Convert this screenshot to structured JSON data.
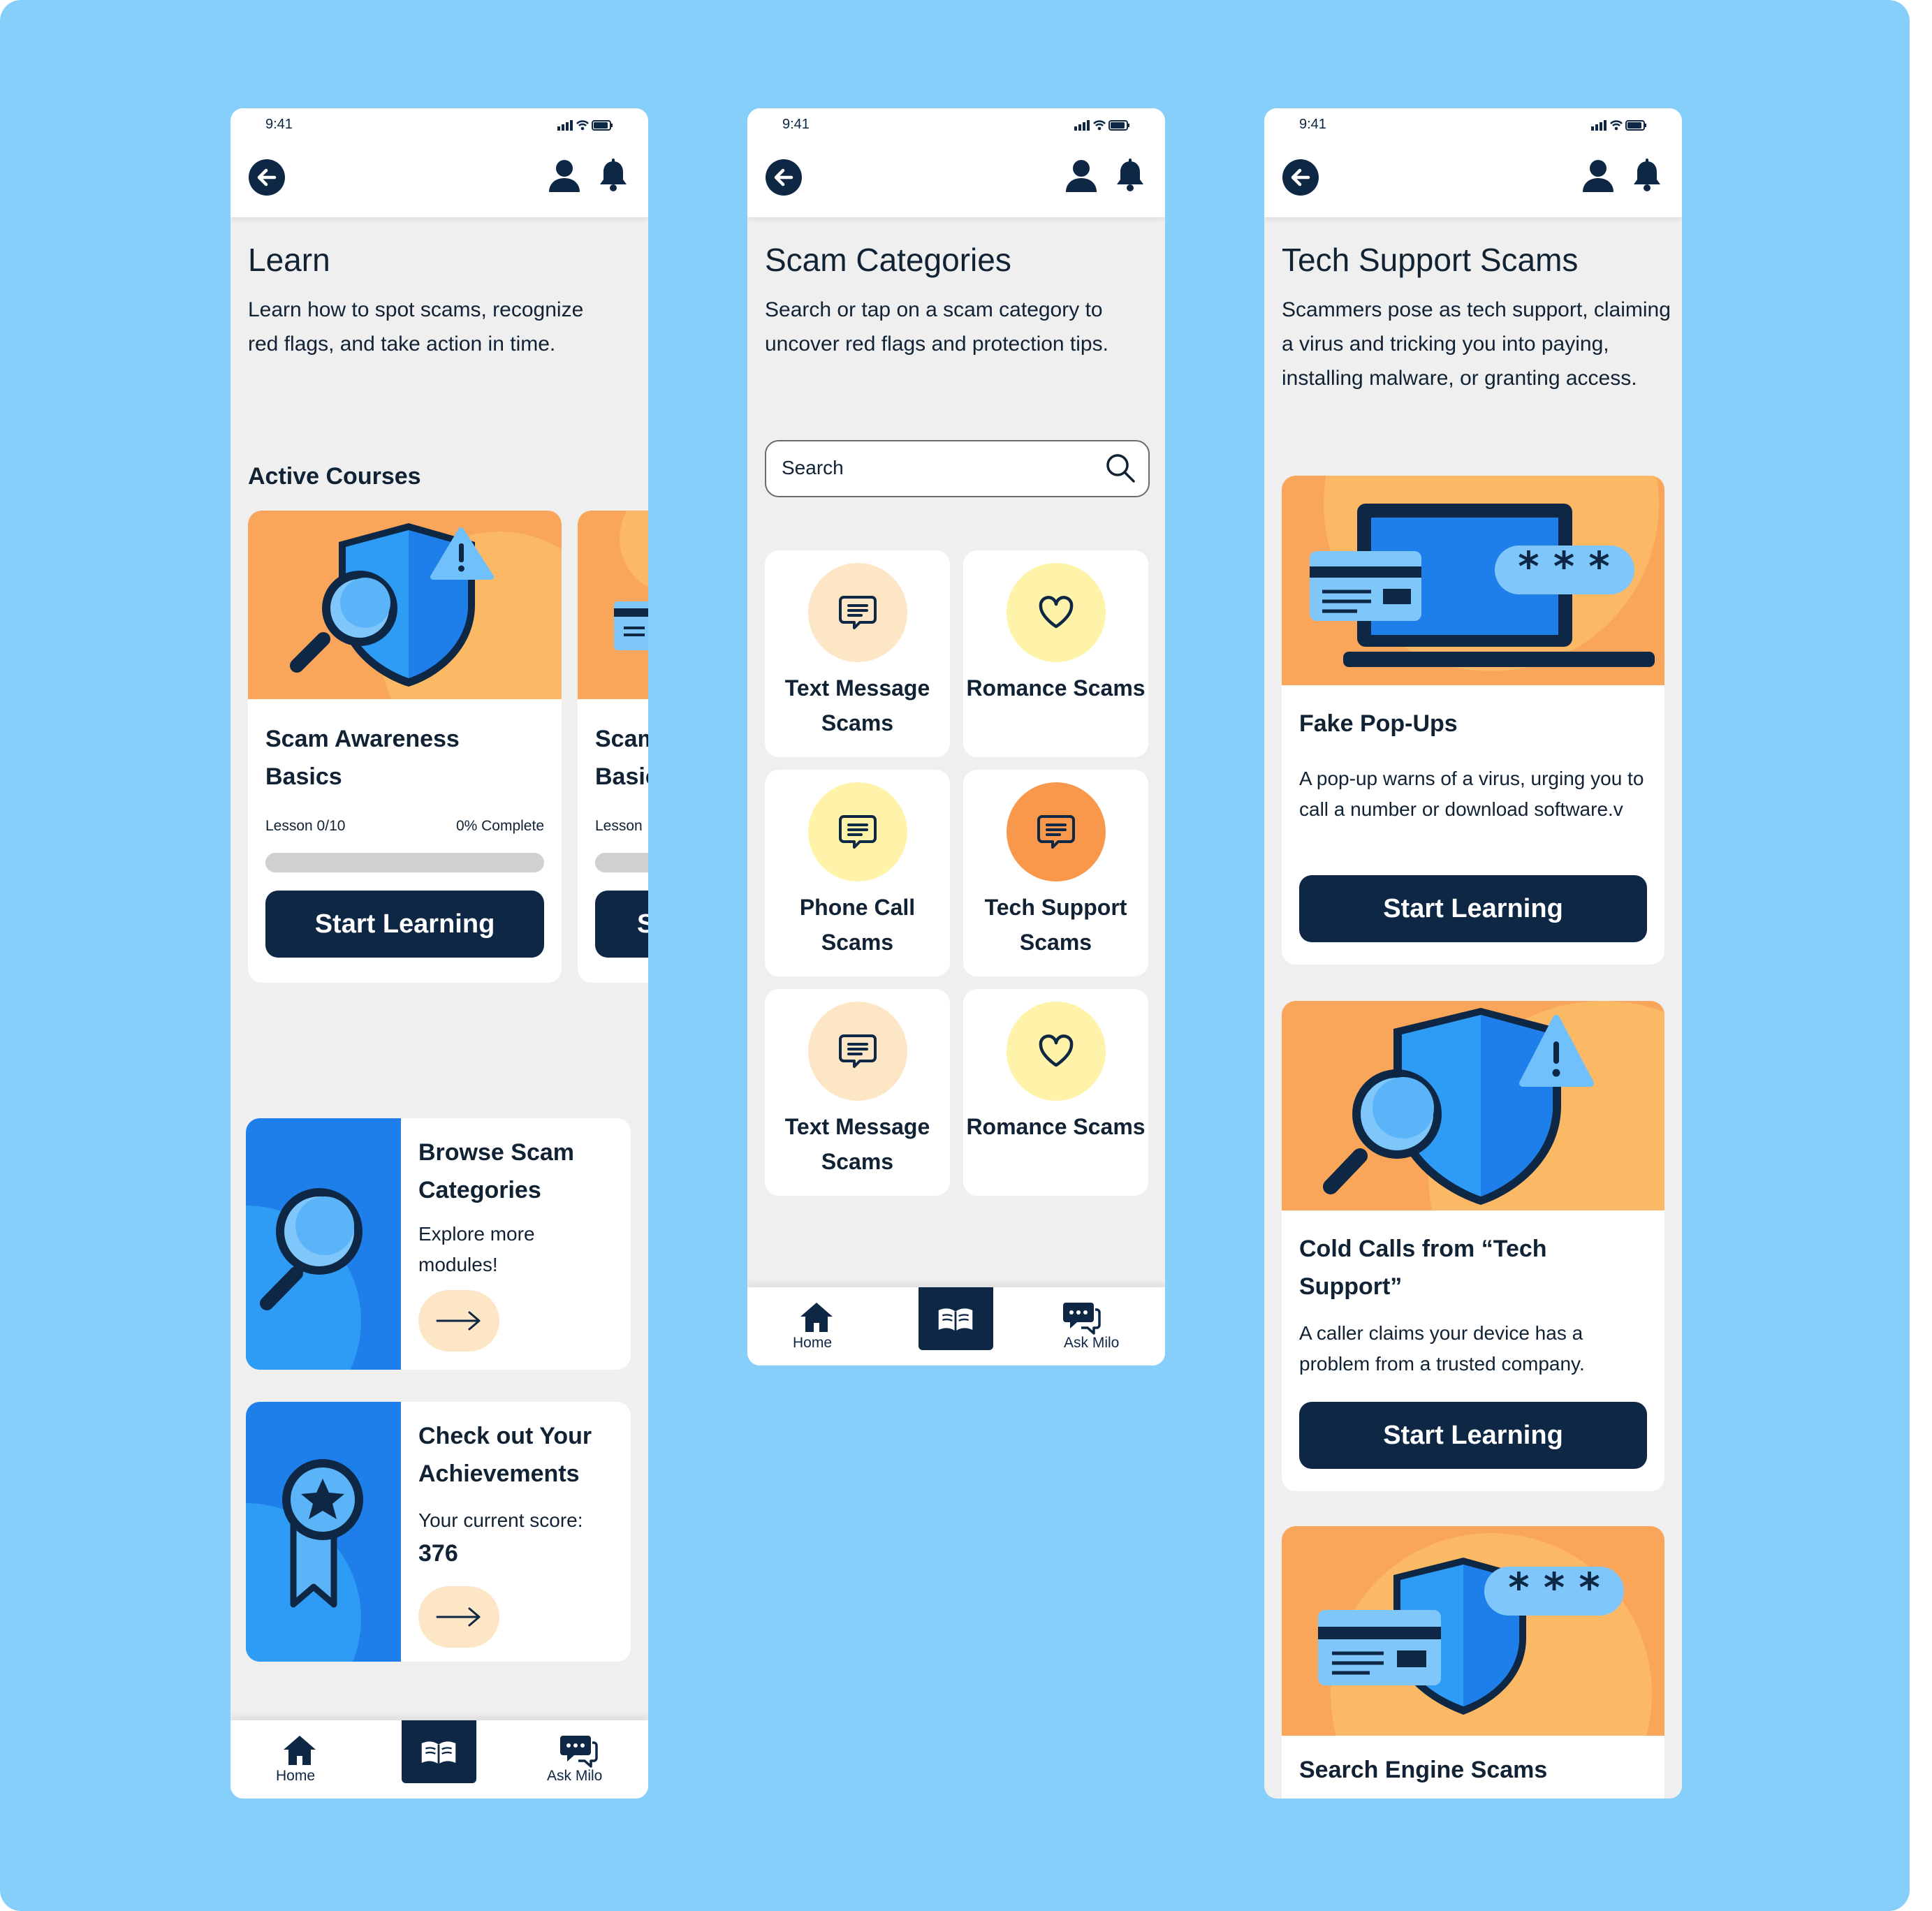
{
  "status": {
    "time": "9:41"
  },
  "learn": {
    "title": "Learn",
    "description": "Learn how to spot scams, recognize red flags, and take action in time.",
    "active_courses_heading": "Active Courses",
    "course": {
      "title": "Scam Awareness Basics",
      "lesson": "Lesson 0/10",
      "complete": "0% Complete",
      "progress_fraction": 0,
      "button": "Start Learning"
    },
    "course_peek": {
      "title": "Scam Basics",
      "lesson": "Lesson",
      "button": "S"
    },
    "browse": {
      "title": "Browse Scam Categories",
      "subtitle": "Explore more modules!"
    },
    "achievements": {
      "title": "Check out Your Achievements",
      "subtitle": "Your current score:",
      "score": "376"
    }
  },
  "nav": {
    "home": "Home",
    "ask": "Ask Milo"
  },
  "categories": {
    "title": "Scam Categories",
    "description": "Search or tap on a scam category to uncover red flags and protection tips.",
    "search_placeholder": "Search",
    "tiles": [
      {
        "label": "Text Message Scams",
        "icon": "message-icon",
        "color": "#FDE6C6"
      },
      {
        "label": "Romance Scams",
        "icon": "heart-icon",
        "color": "#FEF3A8"
      },
      {
        "label": "Phone Call Scams",
        "icon": "message-icon",
        "color": "#FEF3A8"
      },
      {
        "label": "Tech Support Scams",
        "icon": "message-icon",
        "color": "#F9984B"
      },
      {
        "label": "Text Message Scams",
        "icon": "message-icon",
        "color": "#FDE6C6"
      },
      {
        "label": "Romance Scams",
        "icon": "heart-icon",
        "color": "#FEF3A8"
      }
    ]
  },
  "tech": {
    "title": "Tech Support Scams",
    "description": "Scammers pose as tech support, claiming a virus and tricking you into paying, installing malware, or granting access.",
    "items": [
      {
        "title": "Fake Pop-Ups",
        "description": "A pop-up warns of a virus, urging you to call a number or download software.v",
        "button": "Start Learning"
      },
      {
        "title": "Cold Calls from “Tech Support”",
        "description": "A caller claims your device has a problem from a trusted company.",
        "button": "Start Learning"
      },
      {
        "title": "Search Engine Scams"
      }
    ]
  },
  "colors": {
    "background": "#87CFFB",
    "navy": "#0E2744",
    "orange": "#F9A55A",
    "blue": "#2E9BF5"
  }
}
